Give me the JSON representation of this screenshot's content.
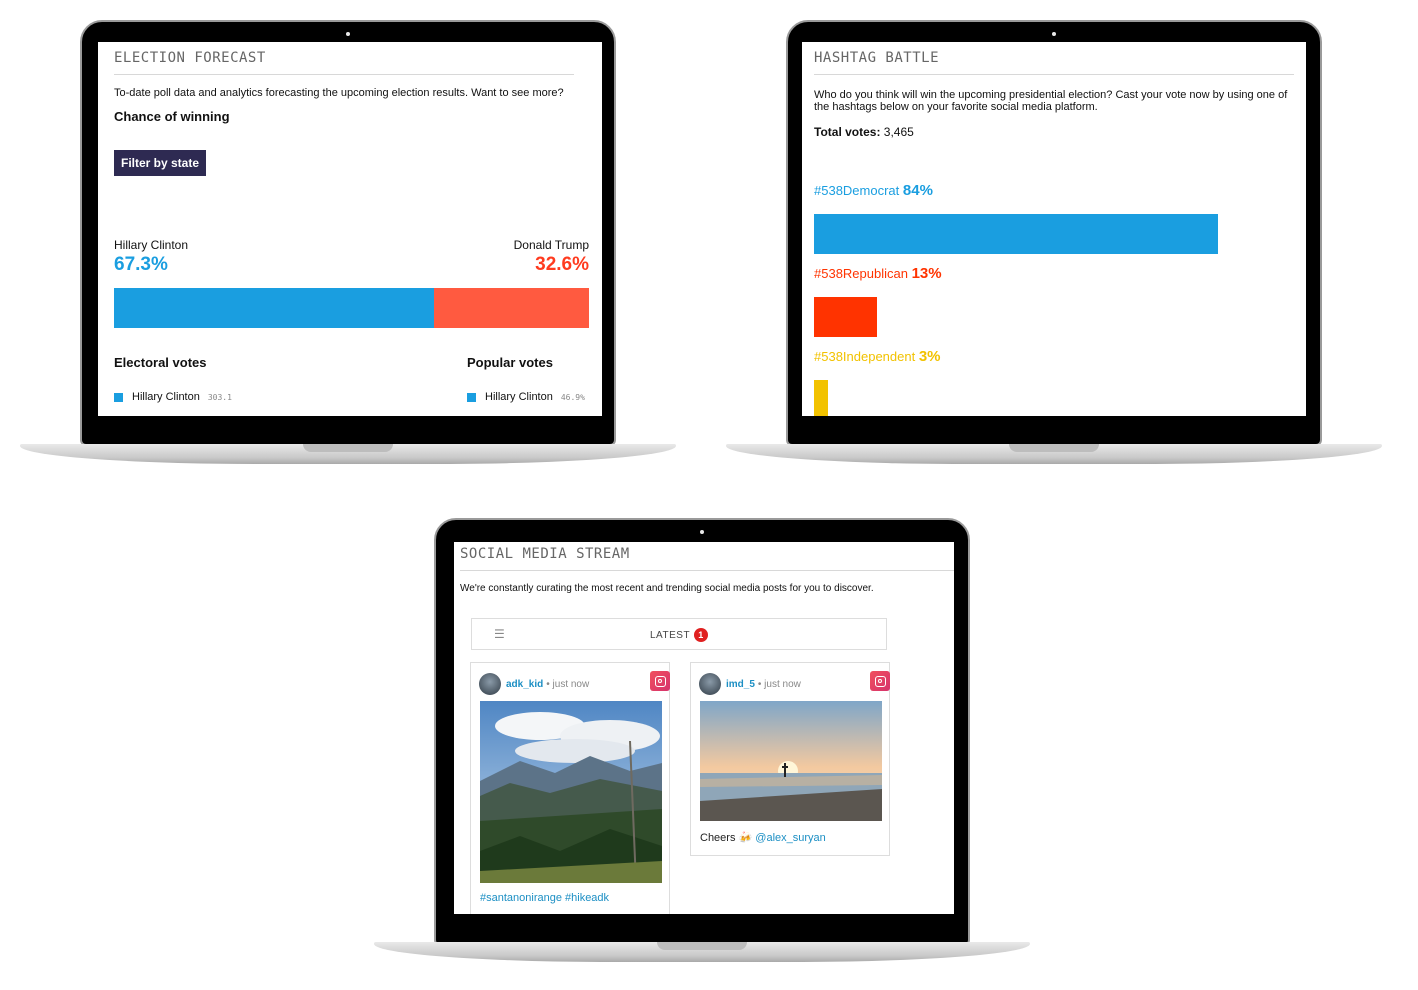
{
  "election_forecast": {
    "title": "ELECTION FORECAST",
    "intro": "To-date poll data and analytics forecasting the upcoming election results. Want to see more?",
    "chance_heading": "Chance of winning",
    "filter_button": "Filter by state",
    "candidates": [
      {
        "name": "Hillary Clinton",
        "pct_label": "67.3%",
        "pct": 67.3,
        "color": "#1a9ee0"
      },
      {
        "name": "Donald Trump",
        "pct_label": "32.6%",
        "pct": 32.6,
        "color": "#ff5a40"
      }
    ],
    "electoral_heading": "Electoral votes",
    "popular_heading": "Popular votes",
    "electoral_legend": {
      "name": "Hillary Clinton",
      "value": "303.1"
    },
    "popular_legend": {
      "name": "Hillary Clinton",
      "value": "46.9%"
    }
  },
  "hashtag_battle": {
    "title": "HASHTAG BATTLE",
    "intro": "Who do you think will win the upcoming presidential election? Cast your vote now by using one of the hashtags below on your favorite social media platform.",
    "total_label": "Total votes:",
    "total_value": "3,465",
    "tags": [
      {
        "tag": "#538Democrat",
        "pct_label": "84%",
        "pct": 84,
        "color": "#1a9ee0"
      },
      {
        "tag": "#538Republican",
        "pct_label": "13%",
        "pct": 13,
        "color": "#ff3300"
      },
      {
        "tag": "#538Independent",
        "pct_label": "3%",
        "pct": 3,
        "color": "#f2c200"
      }
    ]
  },
  "social_stream": {
    "title": "SOCIAL MEDIA STREAM",
    "intro": "We're constantly curating the most recent and trending social media posts for you to discover.",
    "tab_label": "LATEST",
    "badge_count": "1",
    "posts": [
      {
        "user": "adk_kid",
        "time": "• just now",
        "caption": "#santanonirange #hikeadk",
        "platform_icon": "instagram-icon"
      },
      {
        "user": "imd_5",
        "time": "• just now",
        "caption_text": "Cheers 🍻 ",
        "mention": "@alex_suryan",
        "platform_icon": "instagram-icon"
      }
    ]
  }
}
